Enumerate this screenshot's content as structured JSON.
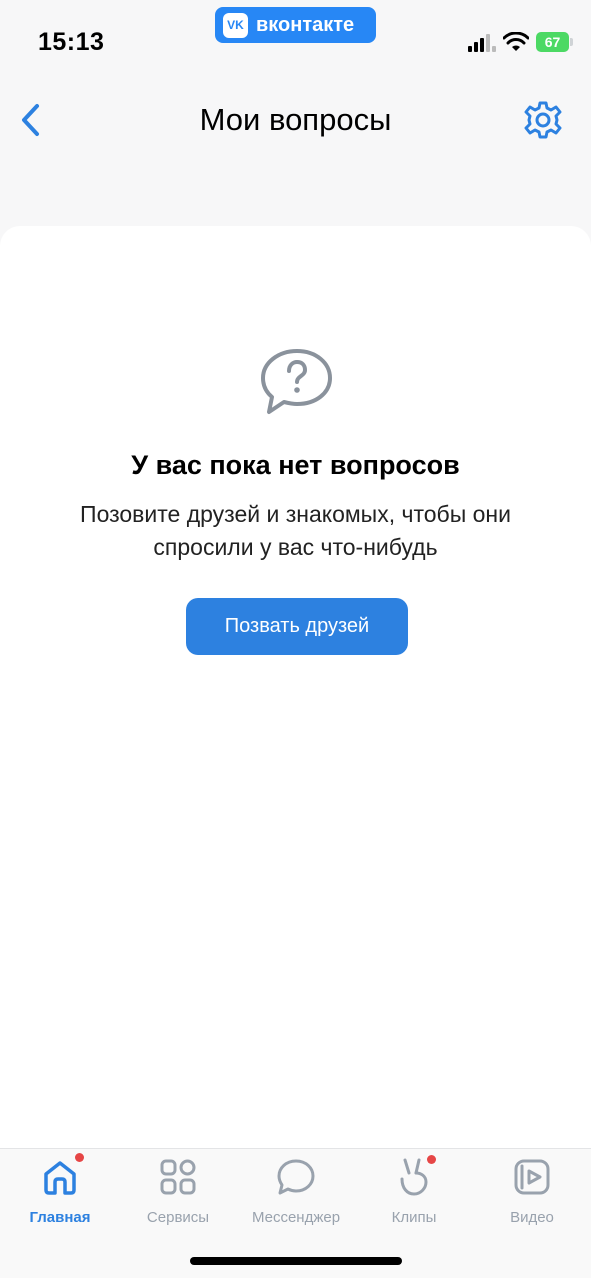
{
  "status_bar": {
    "time": "15:13",
    "app_badge": "вконтакте",
    "battery": "67",
    "icons": [
      "signal-icon",
      "wifi-icon",
      "battery-icon"
    ]
  },
  "header": {
    "title": "Мои вопросы",
    "back_icon": "chevron-left-icon",
    "settings_icon": "gear-icon"
  },
  "empty_state": {
    "icon": "question-bubble-icon",
    "title": "У вас пока нет вопросов",
    "description": "Позовите друзей и знакомых, чтобы они спросили у вас что-нибудь",
    "button_label": "Позвать друзей"
  },
  "tab_bar": {
    "items": [
      {
        "label": "Главная",
        "icon": "home-icon",
        "active": true,
        "badge": true
      },
      {
        "label": "Сервисы",
        "icon": "grid-icon",
        "active": false,
        "badge": false
      },
      {
        "label": "Мессенджер",
        "icon": "chat-icon",
        "active": false,
        "badge": false
      },
      {
        "label": "Клипы",
        "icon": "clips-icon",
        "active": false,
        "badge": true
      },
      {
        "label": "Видео",
        "icon": "video-icon",
        "active": false,
        "badge": false
      }
    ]
  },
  "colors": {
    "accent": "#2d81e0",
    "vk_blue": "#2787f5",
    "badge_red": "#e64646",
    "inactive": "#99a2ad"
  }
}
